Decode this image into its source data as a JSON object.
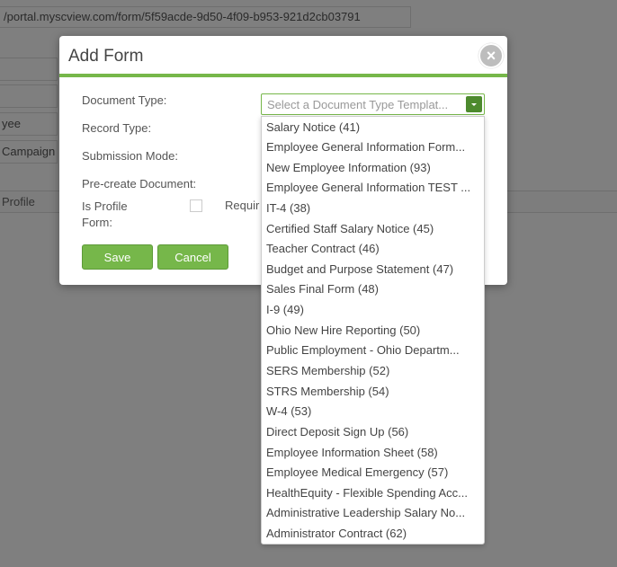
{
  "background": {
    "url": "/portal.myscview.com/form/5f59acde-9d50-4f09-b953-921d2cb03791",
    "field_employee": "yee",
    "field_campaign": "Campaign",
    "tab_profile": "Profile"
  },
  "modal": {
    "title": "Add Form",
    "close_label": "×",
    "labels": {
      "document_type": "Document Type:",
      "record_type": "Record Type:",
      "submission_mode": "Submission Mode:",
      "precreate": "Pre-create Document:",
      "is_profile": "Is Profile Form:",
      "required": "Requir"
    },
    "select": {
      "placeholder": "Select a Document Type Templat..."
    },
    "save_label": "Save",
    "cancel_label": "Cancel"
  },
  "dropdown": {
    "options": [
      "Salary Notice (41)",
      "Employee General Information Form...",
      "New Employee Information (93)",
      "Employee General Information TEST ...",
      "IT-4 (38)",
      "Certified Staff Salary Notice (45)",
      "Teacher Contract (46)",
      "Budget and Purpose Statement (47)",
      "Sales Final Form (48)",
      "I-9 (49)",
      "Ohio New Hire Reporting (50)",
      "Public Employment - Ohio Departm...",
      "SERS Membership (52)",
      "STRS Membership (54)",
      "W-4 (53)",
      "Direct Deposit Sign Up (56)",
      "Employee Information Sheet (58)",
      "Employee Medical Emergency (57)",
      "HealthEquity - Flexible Spending Acc...",
      "Administrative Leadership Salary No...",
      "Administrator Contract (62)"
    ]
  }
}
